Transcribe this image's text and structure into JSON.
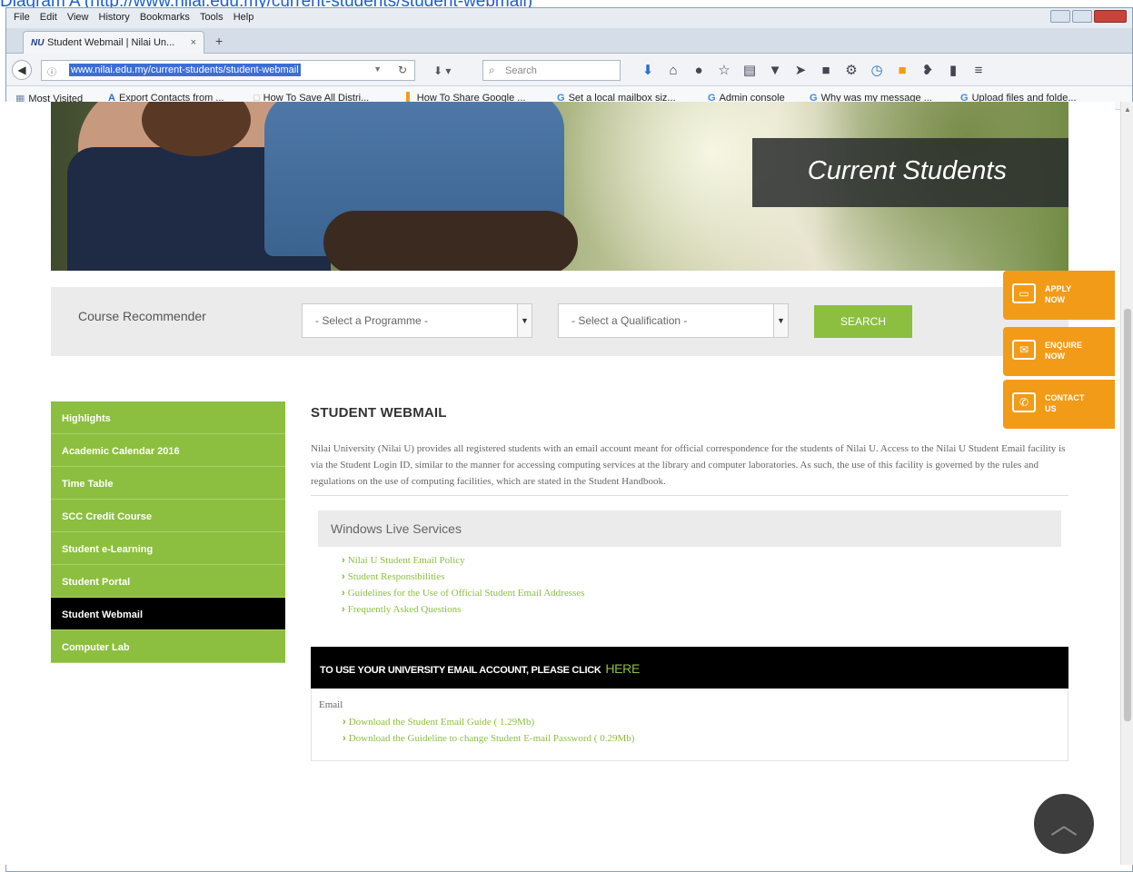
{
  "caption": {
    "prefix": "Diagram A (",
    "link": "http://www.nilai.edu.my/current-students/student-webmail",
    "suffix": ")"
  },
  "browser": {
    "menu": [
      "File",
      "Edit",
      "View",
      "History",
      "Bookmarks",
      "Tools",
      "Help"
    ],
    "tab_title": "Student Webmail | Nilai Un...",
    "tab_favicon": "NU",
    "url": "www.nilai.edu.my/current-students/student-webmail",
    "search_placeholder": "Search",
    "toolbar_icons": [
      "download-arrow-icon",
      "home-icon",
      "chat-icon",
      "star-icon",
      "bookmark-list-icon",
      "pocket-icon",
      "send-icon",
      "stop-icon",
      "settings-icon",
      "clock-icon",
      "rss-icon",
      "extension-icon",
      "phone-icon",
      "menu-icon"
    ],
    "bookmarks": [
      {
        "icon": "folder-icon",
        "label": "Most Visited"
      },
      {
        "icon": "A",
        "label": "Export Contacts from ..."
      },
      {
        "icon": "page-icon",
        "label": "How To Save All Distri..."
      },
      {
        "icon": "doc-icon",
        "label": "How To Share Google ..."
      },
      {
        "icon": "G",
        "label": "Set a local mailbox siz..."
      },
      {
        "icon": "G",
        "label": "Admin console"
      },
      {
        "icon": "G",
        "label": "Why was my message ..."
      },
      {
        "icon": "G",
        "label": "Upload files and folde..."
      }
    ]
  },
  "hero": {
    "title": "Current Students"
  },
  "recommender": {
    "label": "Course Recommender",
    "programme_select": "- Select a Programme -",
    "qualification_select": "- Select a Qualification -",
    "search_button": "SEARCH"
  },
  "float_buttons": [
    {
      "icon": "laptop-icon",
      "label_line1": "APPLY",
      "label_line2": "NOW"
    },
    {
      "icon": "envelope-icon",
      "label_line1": "ENQUIRE",
      "label_line2": "NOW"
    },
    {
      "icon": "phone-icon",
      "label_line1": "CONTACT",
      "label_line2": "US"
    }
  ],
  "sidemenu": [
    {
      "label": "Highlights",
      "active": false
    },
    {
      "label": "Academic Calendar 2016",
      "active": false
    },
    {
      "label": "Time Table",
      "active": false
    },
    {
      "label": "SCC Credit Course",
      "active": false
    },
    {
      "label": "Student e-Learning",
      "active": false
    },
    {
      "label": "Student Portal",
      "active": false
    },
    {
      "label": "Student Webmail",
      "active": true
    },
    {
      "label": "Computer Lab",
      "active": false
    }
  ],
  "main": {
    "heading": "STUDENT WEBMAIL",
    "intro": "Nilai University (Nilai U) provides all registered students with an email account meant for official correspondence for the students of Nilai U. Access to the Nilai U Student Email facility is via the Student Login ID, similar to the manner for accessing computing services at the library and computer laboratories. As such, the use of this facility is governed by the rules and regulations on the use of computing facilities, which are stated in the Student Handbook.",
    "windows_live_heading": "Windows Live Services",
    "windows_live_links": [
      "Nilai U Student Email Policy",
      "Student Responsibilities",
      "Guidelines for the Use of Official Student Email Addresses",
      "Frequently Asked Questions"
    ],
    "email_bar_text": "TO USE YOUR UNIVERSITY EMAIL ACCOUNT, PLEASE CLICK",
    "email_bar_link": "HERE",
    "email_label": "Email",
    "email_links": [
      "Download the Student Email Guide ( 1.29Mb)",
      "Download the Guideline to change Student E-mail Password ( 0.29Mb)"
    ]
  },
  "colors": {
    "accent_green": "#8cbf3f",
    "accent_orange": "#f29b19",
    "link_blue": "#1a5fd6"
  }
}
